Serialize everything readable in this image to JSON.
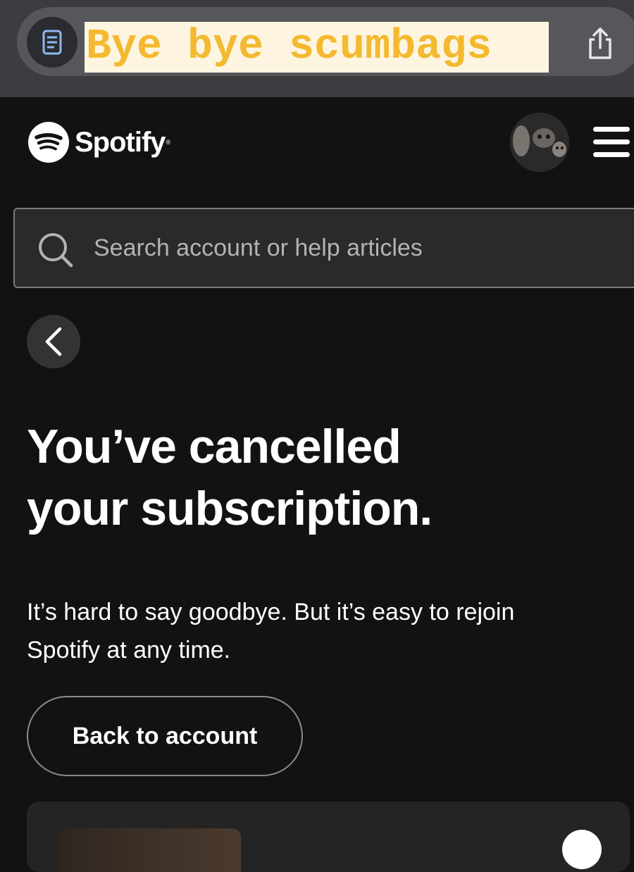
{
  "browser": {
    "annotation_text": "Bye bye scumbags",
    "reader_icon": "reader-mode-icon",
    "share_icon": "share-icon"
  },
  "header": {
    "brand": "Spotify",
    "brand_mark": "®",
    "avatar_icon": "avatar",
    "menu_icon": "hamburger-menu-icon"
  },
  "search": {
    "placeholder": "Search account or help articles",
    "icon": "search-icon"
  },
  "main": {
    "back_icon": "chevron-left-icon",
    "title_line1": "You’ve cancelled",
    "title_line2": "your subscription.",
    "body_line1": "It’s hard to say goodbye. But it’s easy to rejoin",
    "body_line2": "Spotify at any time.",
    "back_to_account_label": "Back to account"
  },
  "colors": {
    "background": "#121212",
    "annotation_text": "#f4b92f",
    "annotation_background": "#fdf5e0"
  }
}
